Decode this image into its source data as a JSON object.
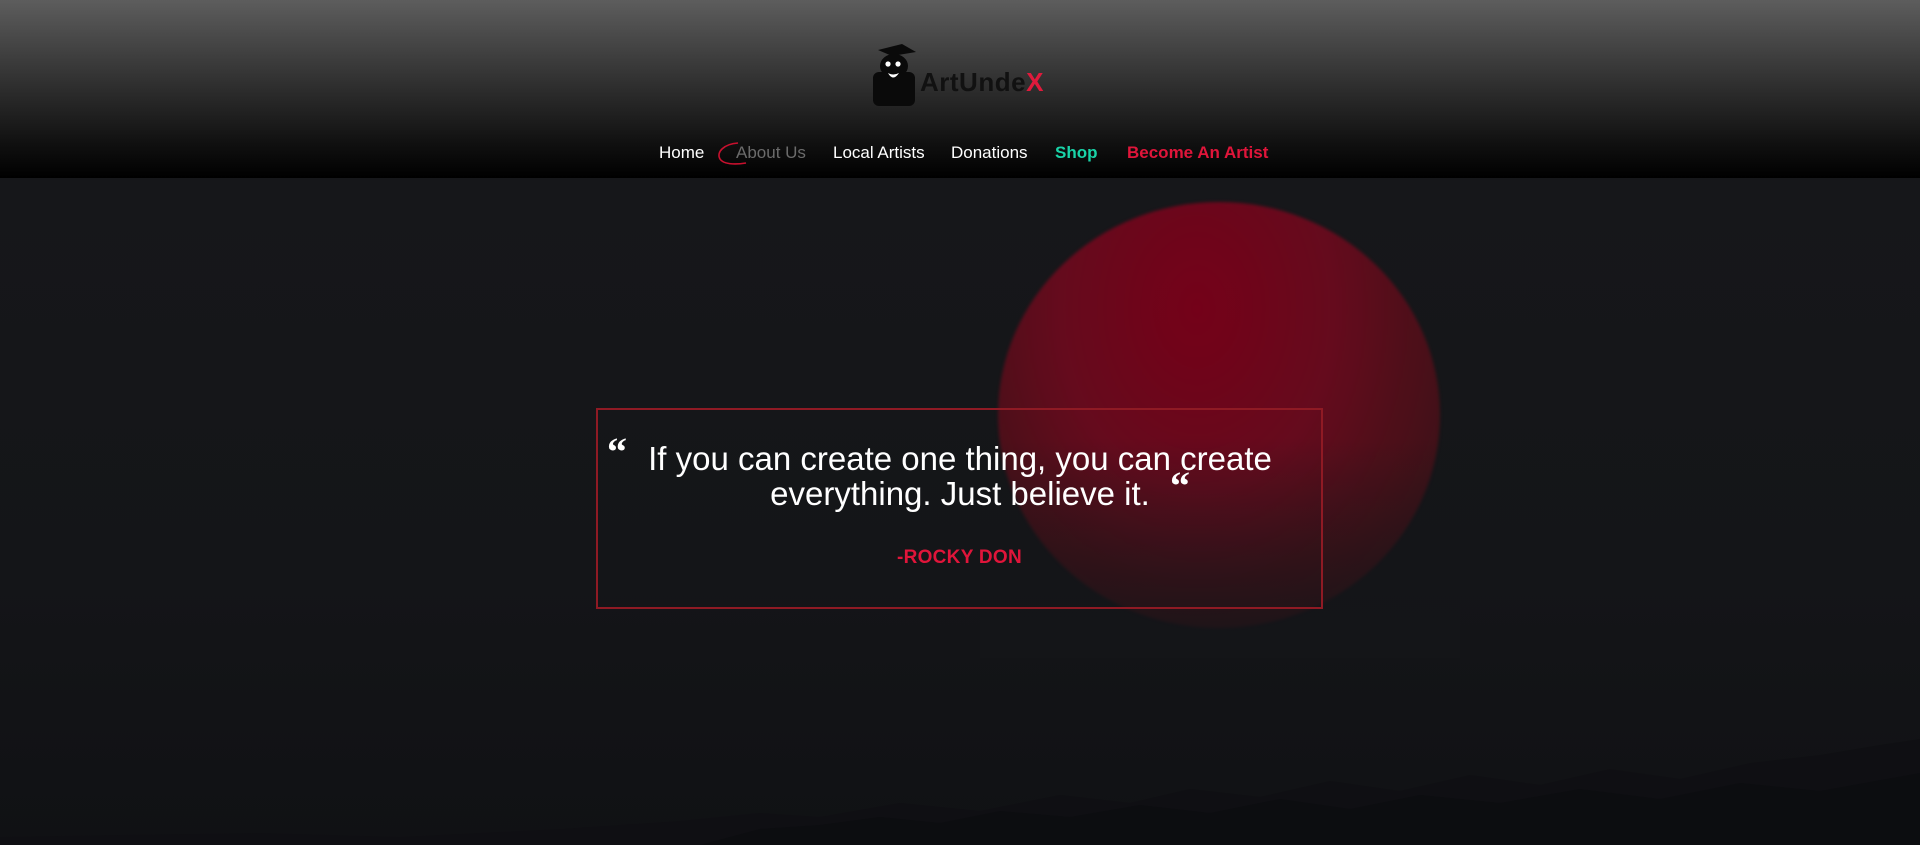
{
  "brand": {
    "name_main": "ArtUnde",
    "name_accent": "X",
    "logo_icon": "owl-graduate-icon",
    "accent_color": "#e0153a"
  },
  "nav": {
    "items": [
      {
        "label": "Home"
      },
      {
        "label": "About Us",
        "state": "active"
      },
      {
        "label": "Local Artists"
      },
      {
        "label": "Donations"
      },
      {
        "label": "Shop",
        "color": "#19d3a8"
      },
      {
        "label": "Become An Artist",
        "color": "#e0153a"
      }
    ]
  },
  "hero": {
    "quote_open_mark": "“",
    "quote_close_mark": "“",
    "quote": "If you can create one thing, you can create everything. Just believe it.",
    "author": "-ROCKY DON"
  }
}
